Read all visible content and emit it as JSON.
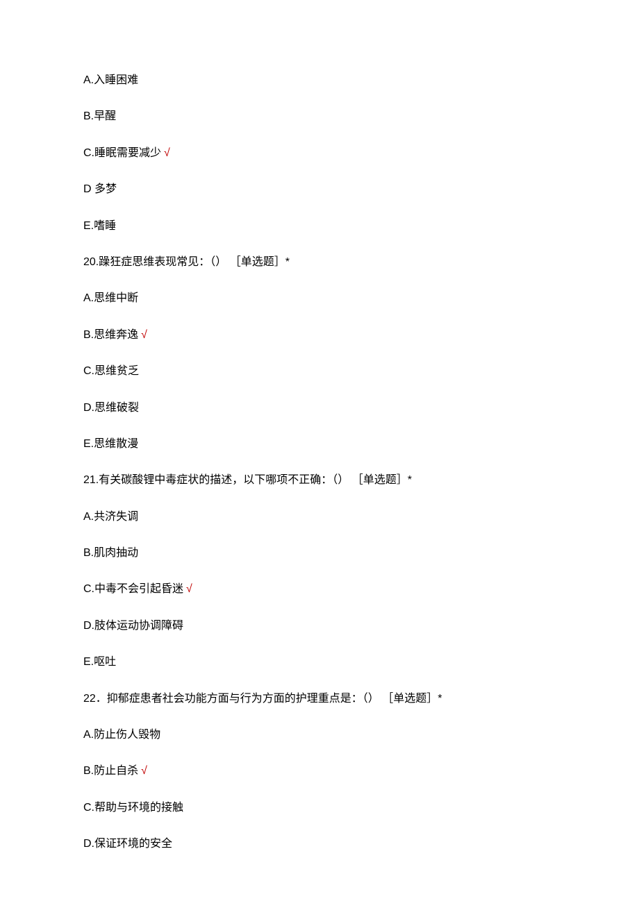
{
  "symbols": {
    "checkmark": "√"
  },
  "items": [
    {
      "type": "option",
      "text": "A.入睡困难",
      "correct": false
    },
    {
      "type": "option",
      "text": "B.早醒",
      "correct": false
    },
    {
      "type": "option",
      "text": "C.睡眠需要减少",
      "correct": true
    },
    {
      "type": "option",
      "text": "D 多梦",
      "correct": false
    },
    {
      "type": "option",
      "text": "E.嗜睡",
      "correct": false
    },
    {
      "type": "question",
      "text": "20.躁狂症思维表现常见：（） ［单选题］*"
    },
    {
      "type": "option",
      "text": "A.思维中断",
      "correct": false
    },
    {
      "type": "option",
      "text": "B.思维奔逸",
      "correct": true
    },
    {
      "type": "option",
      "text": "C.思维贫乏",
      "correct": false
    },
    {
      "type": "option",
      "text": "D.思维破裂",
      "correct": false
    },
    {
      "type": "option",
      "text": "E.思维散漫",
      "correct": false
    },
    {
      "type": "question",
      "text": "21.有关碳酸锂中毒症状的描述，以下哪项不正确：（） ［单选题］*"
    },
    {
      "type": "option",
      "text": "A.共济失调",
      "correct": false
    },
    {
      "type": "option",
      "text": "B.肌肉抽动",
      "correct": false
    },
    {
      "type": "option",
      "text": "C.中毒不会引起昏迷",
      "correct": true
    },
    {
      "type": "option",
      "text": "D.肢体运动协调障碍",
      "correct": false
    },
    {
      "type": "option",
      "text": "E.呕吐",
      "correct": false
    },
    {
      "type": "question",
      "text": "22．抑郁症患者社会功能方面与行为方面的护理重点是：（） ［单选题］*"
    },
    {
      "type": "option",
      "text": "A.防止伤人毁物",
      "correct": false
    },
    {
      "type": "option",
      "text": "B.防止自杀",
      "correct": true
    },
    {
      "type": "option",
      "text": "C.帮助与环境的接触",
      "correct": false
    },
    {
      "type": "option",
      "text": "D.保证环境的安全",
      "correct": false
    }
  ]
}
